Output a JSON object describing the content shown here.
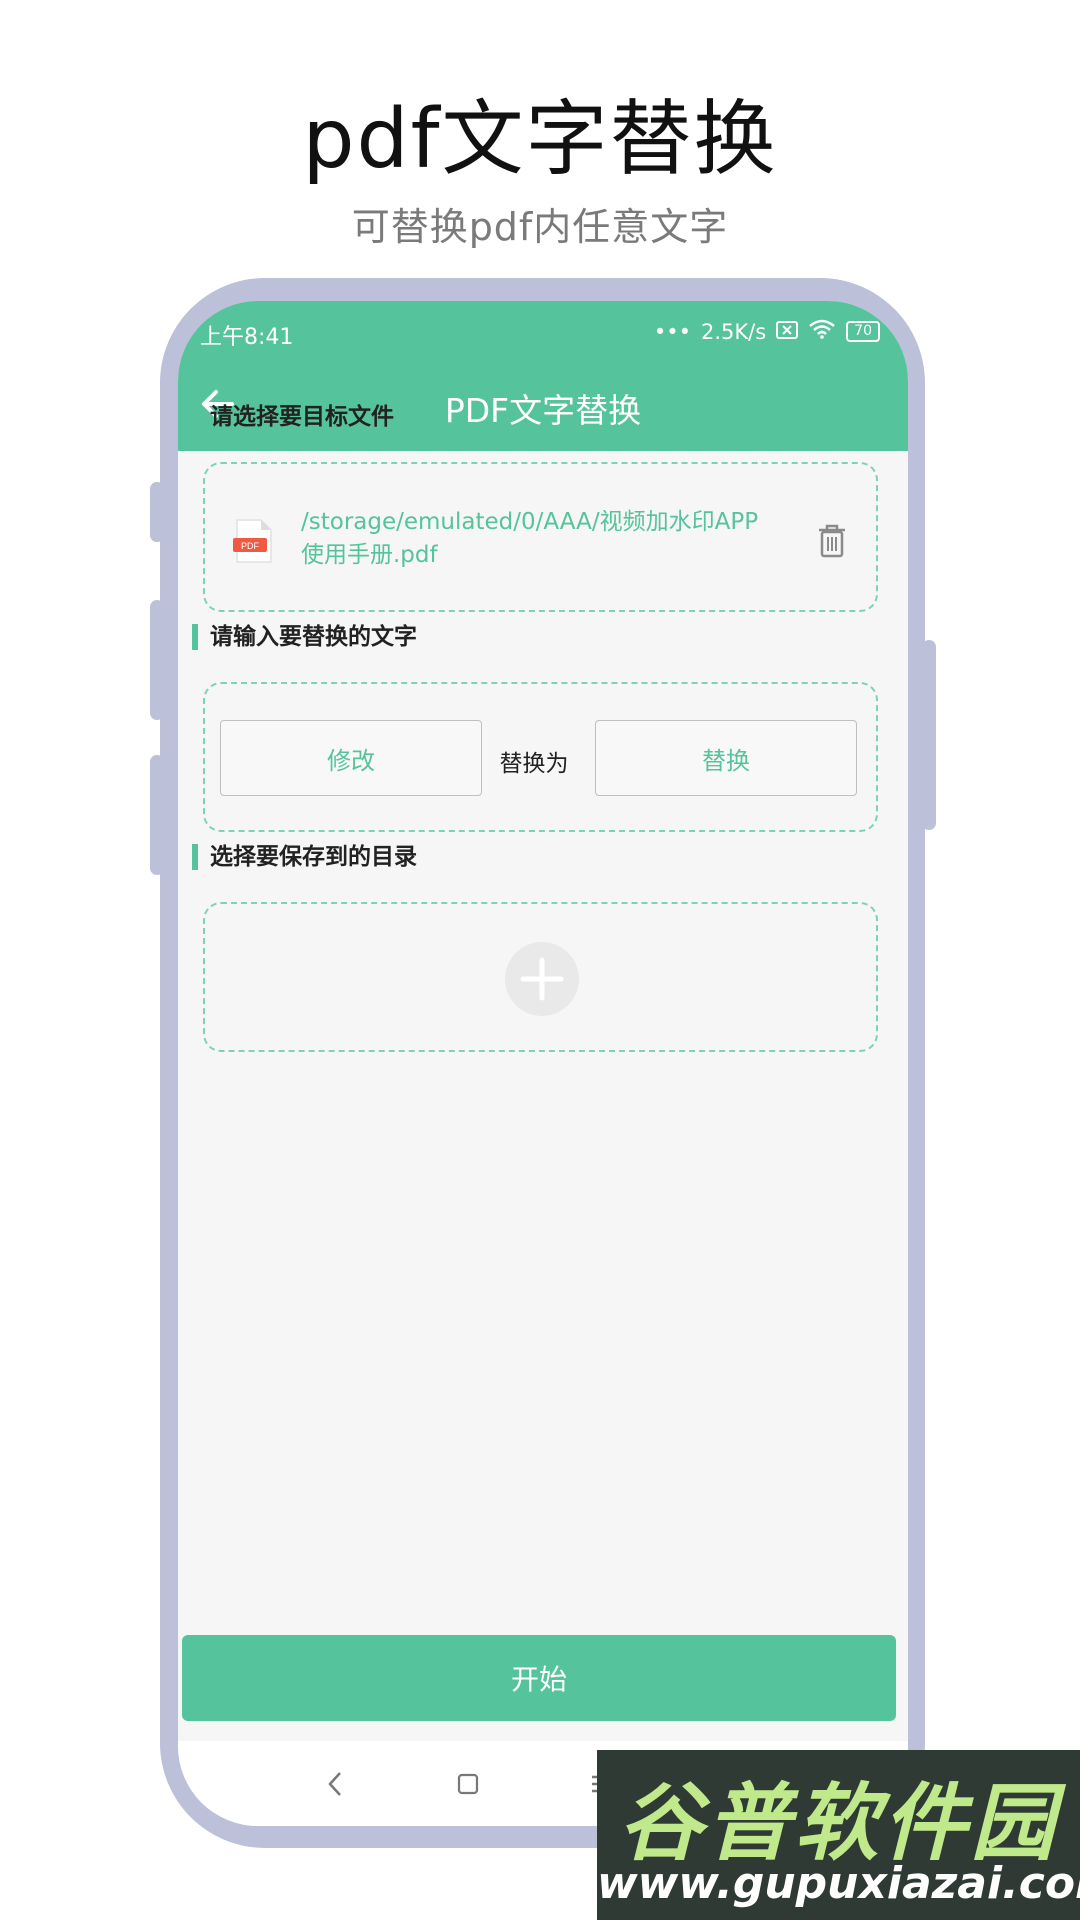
{
  "promo": {
    "title": "pdf文字替换",
    "subtitle": "可替换pdf内任意文字"
  },
  "status_bar": {
    "time": "上午8:41",
    "network_speed": "2.5K/s",
    "battery": "70"
  },
  "app_bar": {
    "title": "PDF文字替换",
    "back_icon": "arrow-left-icon"
  },
  "sections": {
    "select_file": {
      "label": "请选择要目标文件",
      "file_path": "/storage/emulated/0/AAA/视频加水印APP 使用手册.pdf",
      "file_icon_text": "PDF"
    },
    "replace_text": {
      "label": "请输入要替换的文字",
      "from_value": "修改",
      "connector": "替换为",
      "to_value": "替换"
    },
    "save_dir": {
      "label": "选择要保存到的目录"
    }
  },
  "start_button": {
    "label": "开始"
  },
  "watermark": {
    "main": "谷普软件园",
    "url": "www.gupuxiazai.com"
  },
  "colors": {
    "accent": "#55c39b",
    "phone_frame": "#bcc0d8"
  }
}
